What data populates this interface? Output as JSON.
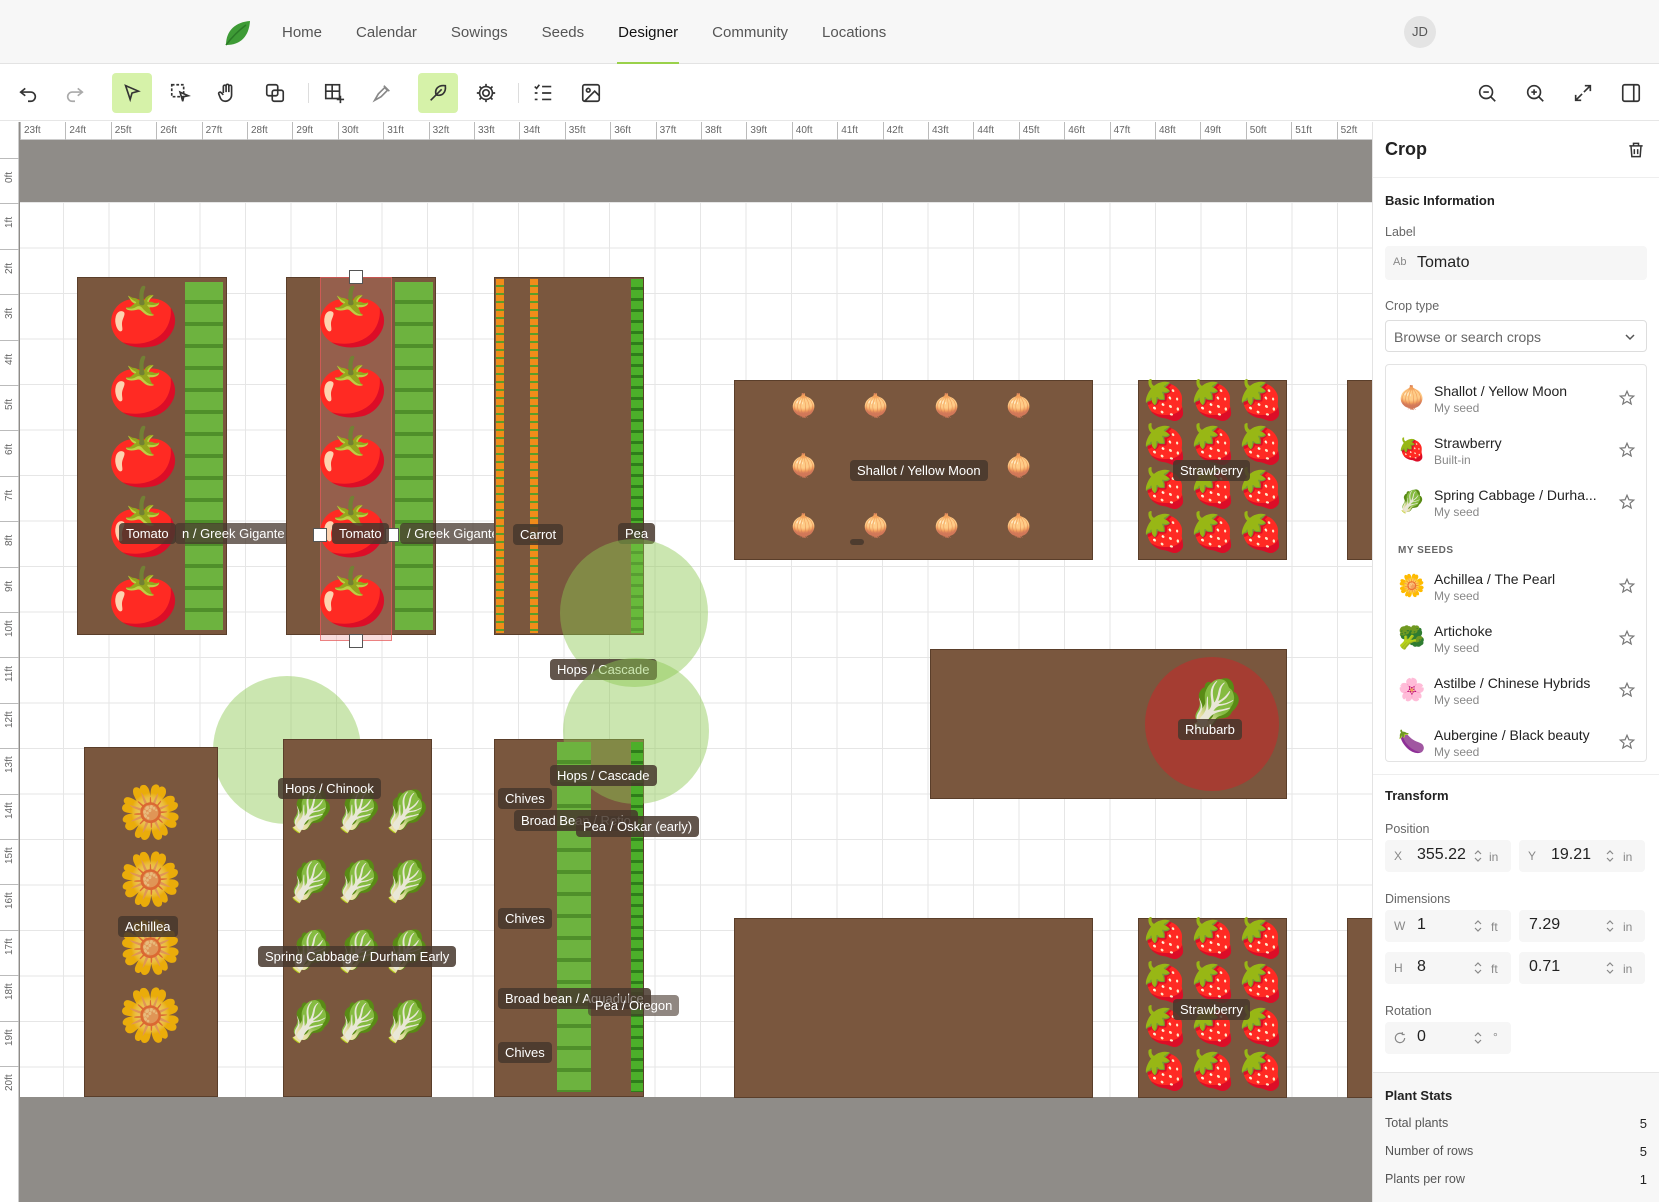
{
  "nav": {
    "items": [
      "Home",
      "Calendar",
      "Sowings",
      "Seeds",
      "Designer",
      "Community",
      "Locations"
    ],
    "active": "Designer",
    "avatar": "JD",
    "brand_color": "#9ad14a"
  },
  "toolbar": {
    "left_tools": [
      "undo-icon",
      "redo-icon",
      "select-icon",
      "lasso-select-icon",
      "pan-hand-icon",
      "duplicate-icon",
      "add-bed-icon",
      "pen-draw-icon",
      "plant-crop-icon",
      "settings-gear-icon",
      "layers-list-icon",
      "image-icon"
    ],
    "right_tools": [
      "zoom-out-icon",
      "zoom-in-icon",
      "fit-screen-icon",
      "sidebar-toggle-icon"
    ],
    "active_color": "#d6f2a9"
  },
  "ruler": {
    "h": [
      "23ft",
      "24ft",
      "25ft",
      "26ft",
      "27ft",
      "28ft",
      "29ft",
      "30ft",
      "31ft",
      "32ft",
      "33ft",
      "34ft",
      "35ft",
      "36ft",
      "37ft",
      "38ft",
      "39ft",
      "40ft",
      "41ft",
      "42ft",
      "43ft",
      "44ft",
      "45ft",
      "46ft",
      "47ft",
      "48ft",
      "49ft",
      "50ft",
      "51ft",
      "52ft"
    ],
    "v": [
      "0ft",
      "1ft",
      "2ft",
      "3ft",
      "4ft",
      "5ft",
      "6ft",
      "7ft",
      "8ft",
      "9ft",
      "10ft",
      "11ft",
      "12ft",
      "13ft",
      "14ft",
      "15ft",
      "16ft",
      "17ft",
      "18ft",
      "19ft",
      "20ft"
    ]
  },
  "canvas": {
    "labels": {
      "tomato1": "Tomato",
      "greek1": "n / Greek Gigante",
      "tomato2": "Tomato",
      "greek2": "/ Greek Gigantes",
      "carrot": "Carrot",
      "pea": "Pea",
      "hops_cascade1": "Hops / Cascade",
      "shallot": "Shallot / Yellow Moon",
      "strawberry1": "Strawberry",
      "rhubarb": "Rhubarb",
      "hops_chinook": "Hops / Chinook",
      "hops_cascade2": "Hops / Cascade",
      "chives1": "Chives",
      "broad_bean1": "Broad Bean / Retio",
      "pea_oskar": "Pea / Oskar (early)",
      "achillea": "Achillea",
      "chives2": "Chives",
      "spring_cabbage": "Spring Cabbage / Durham Early",
      "broad_bean2": "Broad bean / Aquadulce",
      "pea_oregon": "Pea / Oregon",
      "chives3": "Chives",
      "strawberry2": "Strawberry"
    },
    "bed_color": "#7a573e"
  },
  "panel": {
    "title": "Crop",
    "basic_info": "Basic Information",
    "label_caption": "Label",
    "label_prefix": "Ab",
    "label_value": "Tomato",
    "crop_type_caption": "Crop type",
    "crop_type_placeholder": "Browse or search crops",
    "top_crops": [
      {
        "icon": "🧅",
        "name": "Shallot / Yellow Moon",
        "sub": "My seed"
      },
      {
        "icon": "🍓",
        "name": "Strawberry",
        "sub": "Built-in"
      },
      {
        "icon": "🥬",
        "name": "Spring Cabbage / Durha...",
        "sub": "My seed"
      }
    ],
    "my_seeds_title": "MY SEEDS",
    "my_seeds": [
      {
        "icon": "🌼",
        "name": "Achillea / The Pearl",
        "sub": "My seed"
      },
      {
        "icon": "🥦",
        "name": "Artichoke",
        "sub": "My seed"
      },
      {
        "icon": "🌸",
        "name": "Astilbe / Chinese Hybrids",
        "sub": "My seed"
      },
      {
        "icon": "🍆",
        "name": "Aubergine / Black beauty",
        "sub": "My seed"
      }
    ],
    "transform": "Transform",
    "position_caption": "Position",
    "pos_x_prefix": "X",
    "pos_x": "355.22",
    "pos_x_unit": "in",
    "pos_y_prefix": "Y",
    "pos_y": "19.21",
    "pos_y_unit": "in",
    "dimensions_caption": "Dimensions",
    "w_prefix": "W",
    "w_ft": "1",
    "w_ft_unit": "ft",
    "w_in": "7.29",
    "w_in_unit": "in",
    "h_prefix": "H",
    "h_ft": "8",
    "h_ft_unit": "ft",
    "h_in": "0.71",
    "h_in_unit": "in",
    "rotation_caption": "Rotation",
    "rotation": "0",
    "rotation_unit": "°",
    "plant_stats": "Plant Stats",
    "stats": [
      {
        "label": "Total plants",
        "value": "5"
      },
      {
        "label": "Number of rows",
        "value": "5"
      },
      {
        "label": "Plants per row",
        "value": "1"
      }
    ]
  }
}
